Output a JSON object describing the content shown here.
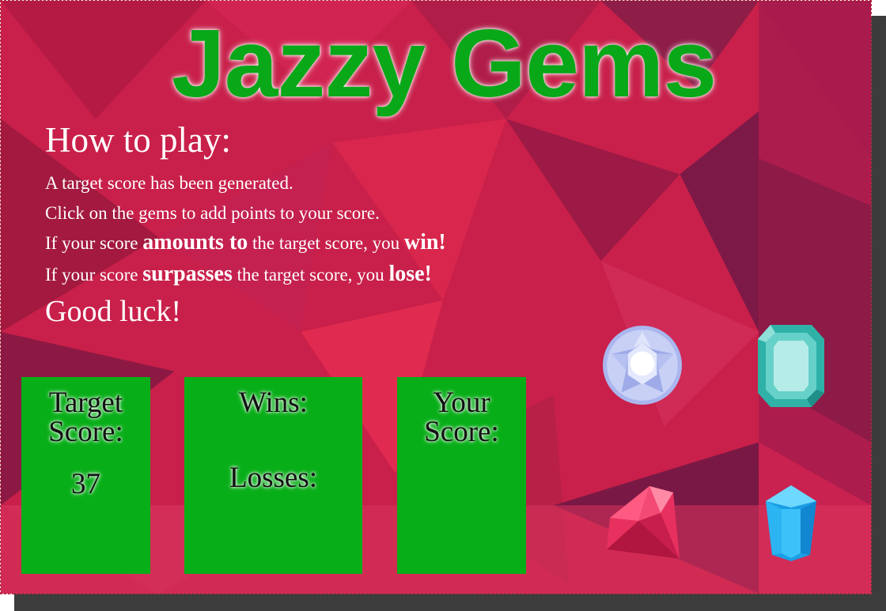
{
  "game": {
    "title": "Jazzy Gems",
    "how_to_play_heading": "How to play:",
    "rules": {
      "line1": "A target score has been generated.",
      "line2": "Click on the gems to add points to your score.",
      "line3_pre": "If your score ",
      "line3_em": "amounts to",
      "line3_mid": " the target score, you ",
      "line3_end": "win!",
      "line4_pre": "If your score ",
      "line4_em": "surpasses",
      "line4_mid": " the target score, you ",
      "line4_end": "lose!"
    },
    "good_luck": "Good luck!"
  },
  "scoreboard": {
    "target_label_1": "Target",
    "target_label_2": "Score:",
    "target_value": "37",
    "wins_label": "Wins:",
    "wins_value": "",
    "losses_label": "Losses:",
    "losses_value": "",
    "your_label_1": "Your",
    "your_label_2": "Score:",
    "your_value": ""
  },
  "gems": [
    {
      "name": "diamond-gem",
      "color": "#c7d0f5"
    },
    {
      "name": "aquamarine-gem",
      "color": "#4fc6c0"
    },
    {
      "name": "ruby-gem",
      "color": "#f04a72"
    },
    {
      "name": "sapphire-gem",
      "color": "#29b7f0"
    }
  ],
  "colors": {
    "background": "#c8204a",
    "title": "#09a818",
    "panel": "#08ae18"
  }
}
